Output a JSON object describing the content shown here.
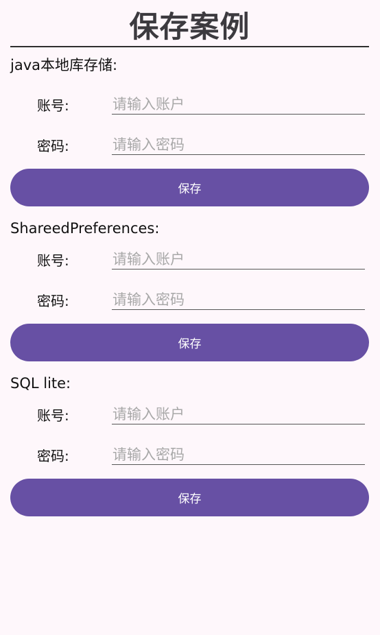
{
  "title": "保存案例",
  "sections": [
    {
      "heading": "java本地库存储:",
      "account_label": "账号:",
      "account_placeholder": "请输入账户",
      "password_label": "密码:",
      "password_placeholder": "请输入密码",
      "save_label": "保存"
    },
    {
      "heading": "ShareedPreferences:",
      "account_label": "账号:",
      "account_placeholder": "请输入账户",
      "password_label": "密码:",
      "password_placeholder": "请输入密码",
      "save_label": "保存"
    },
    {
      "heading": "SQL lite:",
      "account_label": "账号:",
      "account_placeholder": "请输入账户",
      "password_label": "密码:",
      "password_placeholder": "请输入密码",
      "save_label": "保存"
    }
  ],
  "colors": {
    "background": "#fef7fb",
    "button": "#6750a4",
    "button_text": "#ffffff",
    "title_text": "#3c3a3f",
    "placeholder": "#a8a8a8"
  }
}
